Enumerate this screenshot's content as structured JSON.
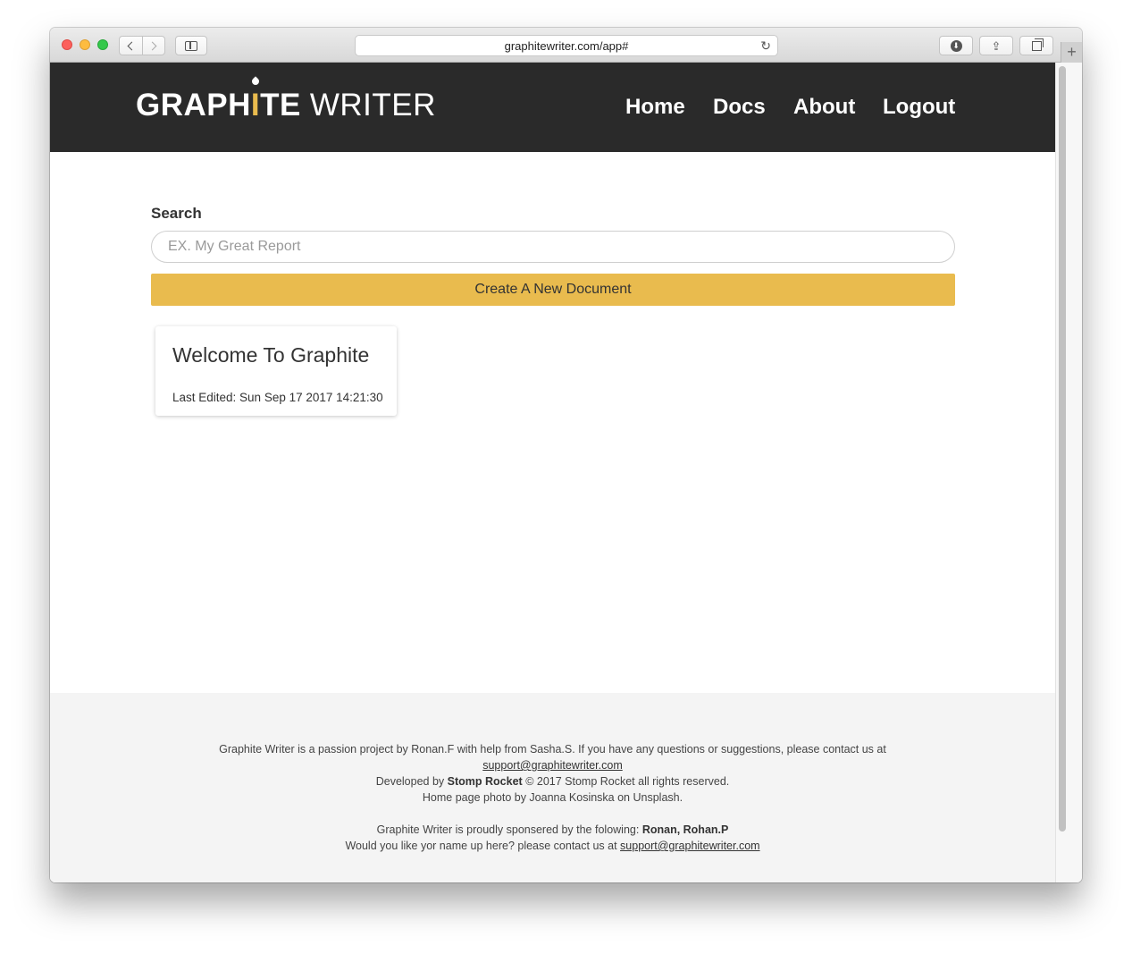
{
  "browser": {
    "url": "graphitewriter.com/app#"
  },
  "header": {
    "logo_bold_prefix": "GRAPH",
    "logo_accent": "I",
    "logo_bold_suffix": "TE",
    "logo_thin": "WRITER",
    "nav": [
      "Home",
      "Docs",
      "About",
      "Logout"
    ]
  },
  "search": {
    "label": "Search",
    "placeholder": "EX. My Great Report"
  },
  "create_button": "Create A New Document",
  "documents": [
    {
      "title": "Welcome To Graphite",
      "last_edited": "Last Edited: Sun Sep 17 2017 14:21:30"
    }
  ],
  "footer": {
    "line1": "Graphite Writer is a passion project by Ronan.F with help from Sasha.S. If you have any questions or suggestions, please contact us at",
    "email": "support@graphitewriter.com",
    "developed_prefix": "Developed by",
    "developer": "Stomp Rocket",
    "developed_suffix": "© 2017 Stomp Rocket all rights reserved.",
    "photo_credit": "Home page photo by Joanna Kosinska on Unsplash.",
    "sponsor_prefix": "Graphite Writer is proudly sponsered by the folowing:",
    "sponsors": "Ronan, Rohan.P",
    "contact_prefix": "Would you like yor name up here? please contact us at",
    "contact_email": "support@graphitewriter.com"
  },
  "colors": {
    "accent": "#e9bb4e",
    "header_bg": "#2a2a2a",
    "footer_bg": "#f4f4f4"
  }
}
